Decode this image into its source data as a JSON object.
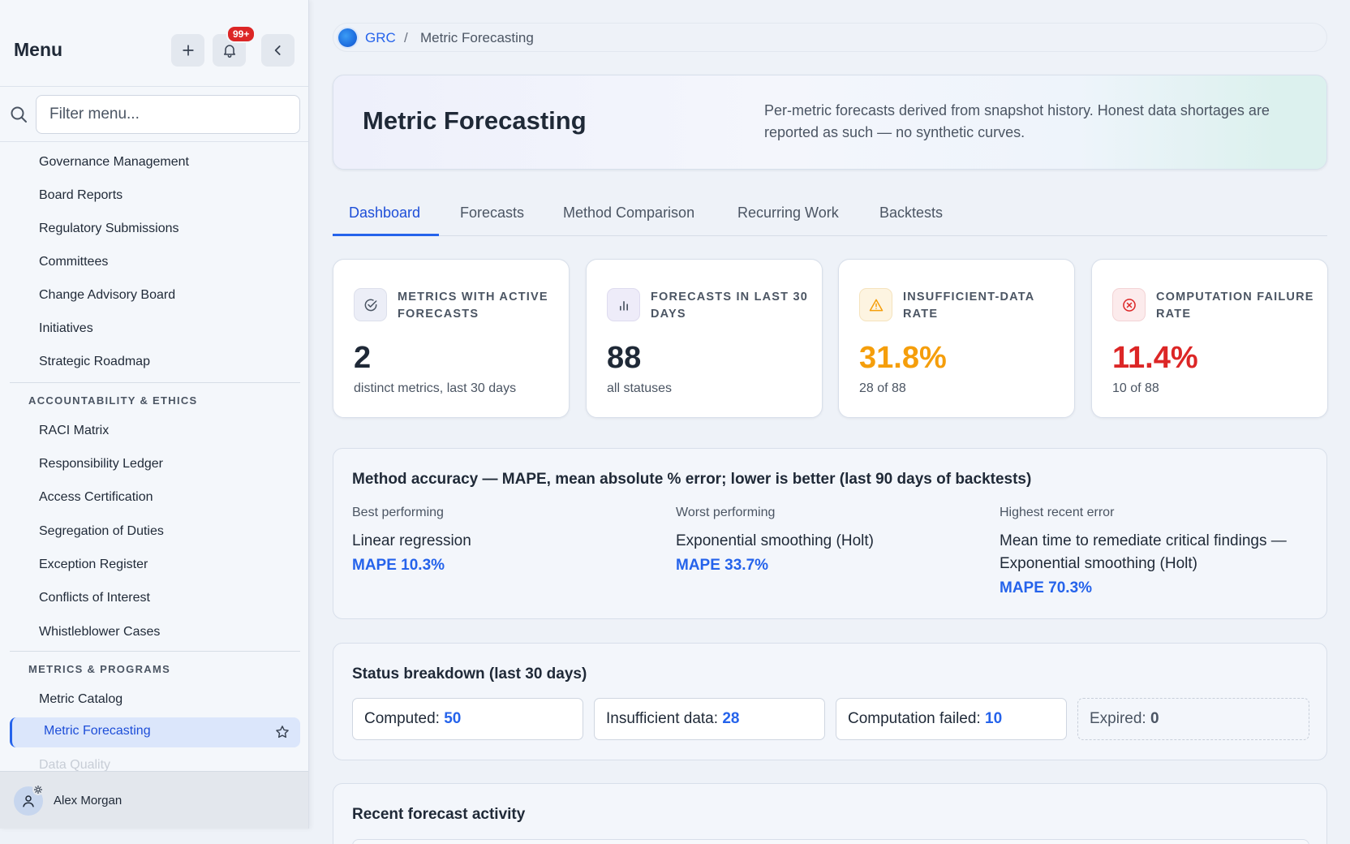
{
  "sidebar": {
    "title": "Menu",
    "notification_badge": "99+",
    "search_placeholder": "Filter menu...",
    "items_governance": [
      "Governance Management",
      "Board Reports",
      "Regulatory Submissions",
      "Committees",
      "Change Advisory Board",
      "Initiatives",
      "Strategic Roadmap"
    ],
    "section_accountability": "ACCOUNTABILITY & ETHICS",
    "items_accountability": [
      "RACI Matrix",
      "Responsibility Ledger",
      "Access Certification",
      "Segregation of Duties",
      "Exception Register",
      "Conflicts of Interest",
      "Whistleblower Cases"
    ],
    "section_metrics": "METRICS & PROGRAMS",
    "items_metrics": [
      "Metric Catalog"
    ],
    "active_item": "Metric Forecasting",
    "faded_item": "Data Quality",
    "user_name": "Alex Morgan"
  },
  "breadcrumb": {
    "root": "GRC",
    "separator": "/",
    "current": "Metric Forecasting"
  },
  "hero": {
    "title": "Metric Forecasting",
    "description": "Per-metric forecasts derived from snapshot history. Honest data shortages are reported as such — no synthetic curves."
  },
  "tabs": [
    "Dashboard",
    "Forecasts",
    "Method Comparison",
    "Recurring Work",
    "Backtests"
  ],
  "active_tab": "Dashboard",
  "kpis": [
    {
      "label": "Metrics with active forecasts",
      "value": "2",
      "sub": "distinct metrics, last 30 days",
      "icon": "check-circle-icon",
      "color": "#1f2937"
    },
    {
      "label": "Forecasts in last 30 days",
      "value": "88",
      "sub": "all statuses",
      "icon": "bar-chart-icon",
      "color": "#1f2937"
    },
    {
      "label": "Insufficient-data rate",
      "value": "31.8%",
      "sub": "28 of 88",
      "icon": "warning-triangle-icon",
      "color": "#f59e0b"
    },
    {
      "label": "Computation failure rate",
      "value": "11.4%",
      "sub": "10 of 88",
      "icon": "x-circle-icon",
      "color": "#dc2626"
    }
  ],
  "accuracy": {
    "title": "Method accuracy — MAPE, mean absolute % error; lower is better (last 90 days of backtests)",
    "best": {
      "caption": "Best performing",
      "method": "Linear regression",
      "mape": "MAPE 10.3%"
    },
    "worst": {
      "caption": "Worst performing",
      "method": "Exponential smoothing (Holt)",
      "mape": "MAPE 33.7%"
    },
    "highest": {
      "caption": "Highest recent error",
      "method": "Mean time to remediate critical findings — Exponential smoothing (Holt)",
      "mape": "MAPE 70.3%"
    }
  },
  "status": {
    "title": "Status breakdown (last 30 days)",
    "items": [
      {
        "label": "Computed:",
        "value": "50"
      },
      {
        "label": "Insufficient data:",
        "value": "28"
      },
      {
        "label": "Computation failed:",
        "value": "10"
      },
      {
        "label": "Expired:",
        "value": "0"
      }
    ]
  },
  "recent": {
    "title": "Recent forecast activity"
  }
}
